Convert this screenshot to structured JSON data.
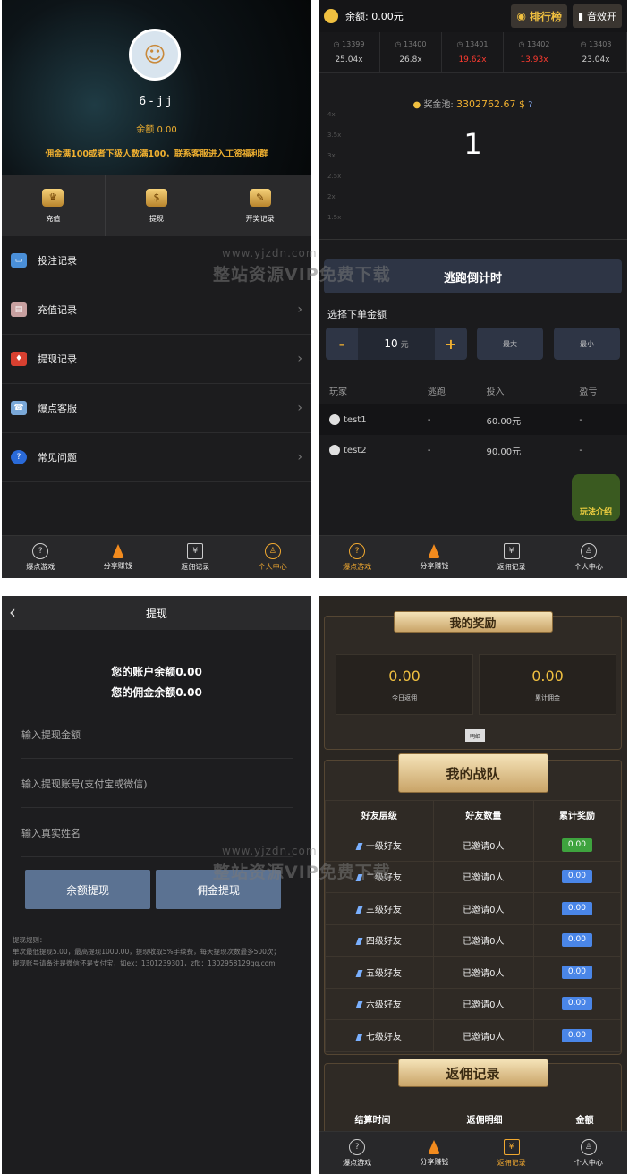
{
  "p1": {
    "username": "6-jj",
    "balance": "余额 0.00",
    "tip": "佣金满100或者下级人数满100，联系客服进入工资福利群",
    "actions": [
      "充值",
      "提现",
      "开奖记录"
    ],
    "menu": [
      "投注记录",
      "充值记录",
      "提现记录",
      "爆点客服",
      "常见问题"
    ]
  },
  "p2": {
    "balance": "余额: 0.00元",
    "rank": "排行榜",
    "sound": "音效开",
    "history": [
      {
        "id": "13399",
        "mult": "25.04x",
        "red": false
      },
      {
        "id": "13400",
        "mult": "26.8x",
        "red": false
      },
      {
        "id": "13401",
        "mult": "19.62x",
        "red": true
      },
      {
        "id": "13402",
        "mult": "13.93x",
        "red": true
      },
      {
        "id": "13403",
        "mult": "23.04x",
        "red": false
      }
    ],
    "pool_label": "奖金池:",
    "pool_value": "3302762.67 $",
    "y_ticks": [
      "4x",
      "3.5x",
      "3x",
      "2.5x",
      "2x",
      "1.5x"
    ],
    "multiplier": "1",
    "run_button": "逃跑倒计时",
    "pick_label": "选择下单金额",
    "amount": "10",
    "unit": "元",
    "max": "最大",
    "min": "最小",
    "cols": [
      "玩家",
      "逃跑",
      "投入",
      "盈亏"
    ],
    "rows": [
      {
        "name": "test1",
        "run": "-",
        "bet": "60.00元",
        "pl": "-"
      },
      {
        "name": "test2",
        "run": "-",
        "bet": "90.00元",
        "pl": "-"
      }
    ],
    "guide": "玩法介绍"
  },
  "p3": {
    "title": "提现",
    "account": "您的账户余额0.00",
    "commission": "您的佣金余额0.00",
    "fields": [
      "输入提现金额",
      "输入提现账号(支付宝或微信)",
      "输入真实姓名"
    ],
    "btn_balance": "余额提现",
    "btn_commission": "佣金提现",
    "rules": "提现规则：\n单次最低提现5.00，最高提现1000.00，提现收取5%手续费，每天提现次数最多500次；\n提现账号请备注是微信还是支付宝，如ex：1301239301，zfb：1302958129qq.com"
  },
  "p4": {
    "reward_title": "我的奖励",
    "today": "0.00",
    "today_label": "今日返佣",
    "total": "0.00",
    "total_label": "累计佣金",
    "detail": "明细",
    "team_title": "我的战队",
    "team_cols": [
      "好友层级",
      "好友数量",
      "累计奖励"
    ],
    "team_rows": [
      {
        "level": "一级好友",
        "count": "已邀请0人",
        "reward": "0.00",
        "green": true
      },
      {
        "level": "二级好友",
        "count": "已邀请0人",
        "reward": "0.00",
        "green": false
      },
      {
        "level": "三级好友",
        "count": "已邀请0人",
        "reward": "0.00",
        "green": false
      },
      {
        "level": "四级好友",
        "count": "已邀请0人",
        "reward": "0.00",
        "green": false
      },
      {
        "level": "五级好友",
        "count": "已邀请0人",
        "reward": "0.00",
        "green": false
      },
      {
        "level": "六级好友",
        "count": "已邀请0人",
        "reward": "0.00",
        "green": false
      },
      {
        "level": "七级好友",
        "count": "已邀请0人",
        "reward": "0.00",
        "green": false
      }
    ],
    "rebate_title": "返佣记录",
    "rebate_cols": [
      "结算时间",
      "返佣明细",
      "金额"
    ]
  },
  "nav": [
    "爆点游戏",
    "分享赚钱",
    "返佣记录",
    "个人中心"
  ],
  "watermark": {
    "url": "www.yjzdn.com",
    "text": "整站资源VIP免费下载"
  }
}
